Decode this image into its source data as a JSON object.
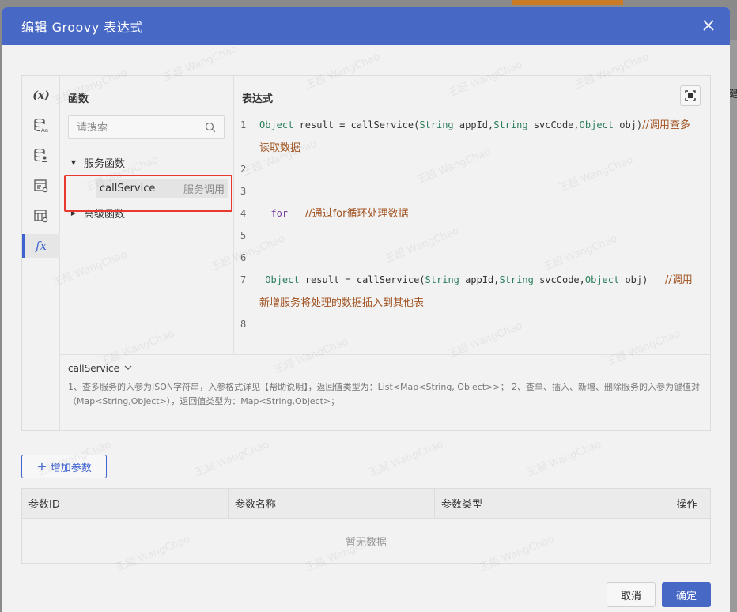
{
  "dialog": {
    "title": "编辑 Groovy 表达式",
    "close_label": "×"
  },
  "rail": {
    "items": [
      {
        "name": "variable",
        "label": "(x)"
      },
      {
        "name": "db-text",
        "icon": "database-text-icon"
      },
      {
        "name": "db-user",
        "icon": "database-user-icon"
      },
      {
        "name": "form-gear",
        "icon": "form-settings-icon"
      },
      {
        "name": "table-gear",
        "icon": "table-settings-icon"
      },
      {
        "name": "function",
        "label": "fx"
      }
    ]
  },
  "functions": {
    "label": "函数",
    "search_placeholder": "请搜索",
    "groups": [
      {
        "label": "服务函数",
        "expanded": true,
        "items": [
          {
            "name": "callService",
            "type": "服务调用"
          }
        ]
      },
      {
        "label": "高级函数",
        "expanded": false
      }
    ]
  },
  "expression": {
    "label": "表达式",
    "lines": [
      {
        "n": "1",
        "parts": [
          {
            "t": "Object",
            "c": "ty"
          },
          {
            "t": " result = callService(",
            "c": ""
          },
          {
            "t": "String",
            "c": "ty"
          },
          {
            "t": " appId,",
            "c": ""
          },
          {
            "t": "String",
            "c": "ty"
          },
          {
            "t": " svcCode,",
            "c": ""
          },
          {
            "t": "Object",
            "c": "ty"
          },
          {
            "t": " obj)",
            "c": ""
          },
          {
            "t": "//调用查多读取数据",
            "c": "cm"
          }
        ]
      },
      {
        "n": "2",
        "parts": []
      },
      {
        "n": "3",
        "parts": []
      },
      {
        "n": "4",
        "parts": [
          {
            "t": "  ",
            "c": ""
          },
          {
            "t": "for",
            "c": "fk"
          },
          {
            "t": "   ",
            "c": ""
          },
          {
            "t": "//通过for循环处理数据",
            "c": "cm"
          }
        ]
      },
      {
        "n": "5",
        "parts": []
      },
      {
        "n": "6",
        "parts": []
      },
      {
        "n": "7",
        "parts": [
          {
            "t": " ",
            "c": ""
          },
          {
            "t": "Object",
            "c": "ty"
          },
          {
            "t": " result = callService(",
            "c": ""
          },
          {
            "t": "String",
            "c": "ty"
          },
          {
            "t": " appId,",
            "c": ""
          },
          {
            "t": "String",
            "c": "ty"
          },
          {
            "t": " svcCode,",
            "c": ""
          },
          {
            "t": "Object",
            "c": "ty"
          },
          {
            "t": " obj)   ",
            "c": ""
          },
          {
            "t": "//调用新增服务将处理的数据插入到其他表",
            "c": "cm"
          }
        ]
      },
      {
        "n": "8",
        "parts": []
      }
    ]
  },
  "description": {
    "title": "callService",
    "text": "1、查多服务的入参为JSON字符串，入参格式详见【帮助说明】，返回值类型为：List<Map<String, Object>>； 2、查单、插入、新增、删除服务的入参为键值对（Map<String,Object>），返回值类型为：Map<String,Object>；"
  },
  "params": {
    "add_label": "增加参数",
    "columns": [
      "参数ID",
      "参数名称",
      "参数类型",
      "操作"
    ],
    "empty_text": "暂无数据"
  },
  "footer": {
    "cancel_label": "取消",
    "confirm_label": "确定"
  },
  "background": {
    "right_char": "键"
  },
  "watermark": "王超 WangChao",
  "colors": {
    "header": "#4868c6",
    "accent": "#3e63d1",
    "highlight": "#e8392f",
    "comment": "#a0521f",
    "type": "#2a7d5a"
  }
}
